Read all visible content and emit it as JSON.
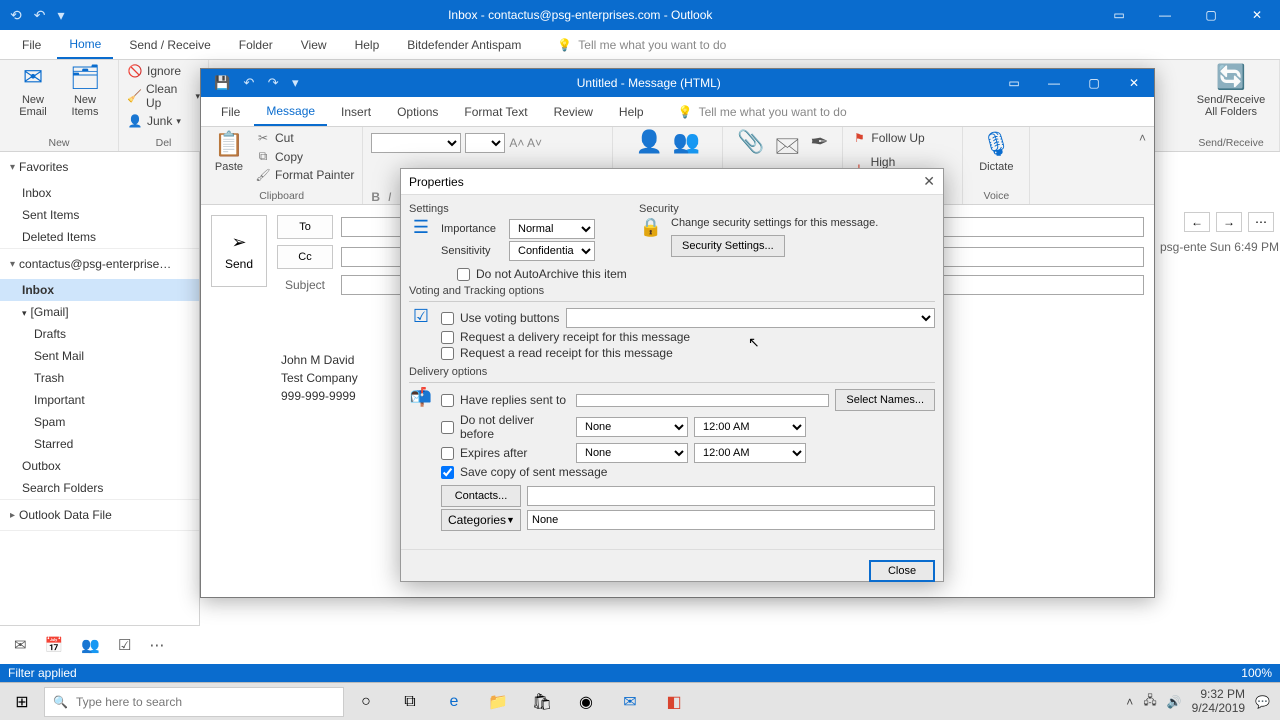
{
  "main": {
    "title": "Inbox - contactus@psg-enterprises.com - Outlook",
    "tabs": [
      "File",
      "Home",
      "Send / Receive",
      "Folder",
      "View",
      "Help",
      "Bitdefender Antispam"
    ],
    "active_tab": "Home",
    "tellme": "Tell me what you want to do",
    "ribbon": {
      "new_group": "New",
      "new_email": "New\nEmail",
      "new_items": "New\nItems",
      "delete_group": "Del",
      "ignore": "Ignore",
      "cleanup": "Clean Up",
      "junk": "Junk",
      "sendrec_group": "Send/Receive",
      "sendrec_btn": "Send/Receive\nAll Folders"
    },
    "status": "Filter applied",
    "zoom": "100%"
  },
  "nav": {
    "favorites": "Favorites",
    "fav_items": [
      "Inbox",
      "Sent Items",
      "Deleted Items"
    ],
    "account": "contactus@psg-enterprise…",
    "inbox": "Inbox",
    "gmail": "[Gmail]",
    "gmail_items": [
      "Drafts",
      "Sent Mail",
      "Trash",
      "Important",
      "Spam",
      "Starred"
    ],
    "outbox": "Outbox",
    "search_folders": "Search Folders",
    "data_file": "Outlook Data File"
  },
  "mail_preview": {
    "from": "psg-ente",
    "date": "Sun 6:49 PM"
  },
  "msg_window": {
    "title": "Untitled - Message (HTML)",
    "tabs": [
      "File",
      "Message",
      "Insert",
      "Options",
      "Format Text",
      "Review",
      "Help"
    ],
    "active_tab": "Message",
    "tellme": "Tell me what you want to do",
    "ribbon": {
      "paste": "Paste",
      "clipboard": "Clipboard",
      "cut": "Cut",
      "copy": "Copy",
      "format_painter": "Format Painter",
      "followup": "Follow Up",
      "high_importance": "High Importance",
      "dictate": "Dictate",
      "voice": "Voice"
    },
    "compose": {
      "send": "Send",
      "to": "To",
      "cc": "Cc",
      "subject": "Subject"
    },
    "signature": {
      "name": "John M David",
      "company": "Test Company",
      "phone": "999-999-9999"
    }
  },
  "props": {
    "title": "Properties",
    "settings": "Settings",
    "security": "Security",
    "importance_label": "Importance",
    "importance_value": "Normal",
    "sensitivity_label": "Sensitivity",
    "sensitivity_value": "Confidential",
    "no_autoarchive": "Do not AutoArchive this item",
    "security_desc": "Change security settings for this message.",
    "security_btn": "Security Settings...",
    "voting_hdr": "Voting and Tracking options",
    "use_voting": "Use voting buttons",
    "req_delivery": "Request a delivery receipt for this message",
    "req_read": "Request a read receipt for this message",
    "delivery_hdr": "Delivery options",
    "have_replies": "Have replies sent to",
    "select_names": "Select Names...",
    "no_deliver_before": "Do not deliver before",
    "expires_after": "Expires after",
    "date_none": "None",
    "time_default": "12:00 AM",
    "save_copy": "Save copy of sent message",
    "contacts": "Contacts...",
    "categories": "Categories",
    "categories_value": "None",
    "close": "Close"
  },
  "taskbar": {
    "search_placeholder": "Type here to search",
    "time": "9:32 PM",
    "date": "9/24/2019"
  }
}
